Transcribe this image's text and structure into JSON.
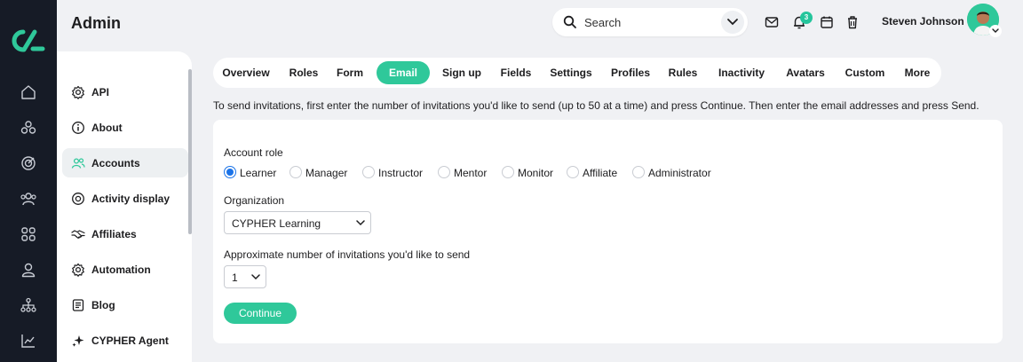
{
  "header": {
    "title": "Admin",
    "search_label": "Search",
    "notification_count": "3",
    "user_name": "Steven Johnson"
  },
  "rail": {
    "icons": [
      "home-icon",
      "courses-icon",
      "target-icon",
      "groups-icon",
      "apps-icon",
      "user-icon",
      "org-chart-icon",
      "analytics-icon"
    ]
  },
  "sidebar": {
    "items": [
      {
        "label": "API",
        "icon": "gear-icon"
      },
      {
        "label": "About",
        "icon": "info-icon"
      },
      {
        "label": "Accounts",
        "icon": "users-icon"
      },
      {
        "label": "Activity display",
        "icon": "target-icon"
      },
      {
        "label": "Affiliates",
        "icon": "handshake-icon"
      },
      {
        "label": "Automation",
        "icon": "gear-icon"
      },
      {
        "label": "Blog",
        "icon": "document-icon"
      },
      {
        "label": "CYPHER Agent",
        "icon": "sparkle-icon"
      }
    ]
  },
  "tabs": [
    "Overview",
    "Roles",
    "Form",
    "Email",
    "Sign up",
    "Fields",
    "Settings",
    "Profiles",
    "Rules",
    "Inactivity",
    "Avatars",
    "Custom",
    "More"
  ],
  "intro_text": "To send invitations, first enter the number of invitations you'd like to send (up to 50 at a time) and press Continue. Then enter the email addresses and press Send.",
  "form": {
    "account_role_label": "Account role",
    "roles": [
      "Learner",
      "Manager",
      "Instructor",
      "Mentor",
      "Monitor",
      "Affiliate",
      "Administrator"
    ],
    "selected_role": "Learner",
    "organization_label": "Organization",
    "organization_value": "CYPHER Learning",
    "count_label": "Approximate number of invitations you'd like to send",
    "count_value": "1",
    "continue_label": "Continue"
  },
  "colors": {
    "accent": "#2fc89a",
    "rail": "#161b26",
    "radio_selected": "#1b73e8",
    "background": "#f0f1f4"
  }
}
